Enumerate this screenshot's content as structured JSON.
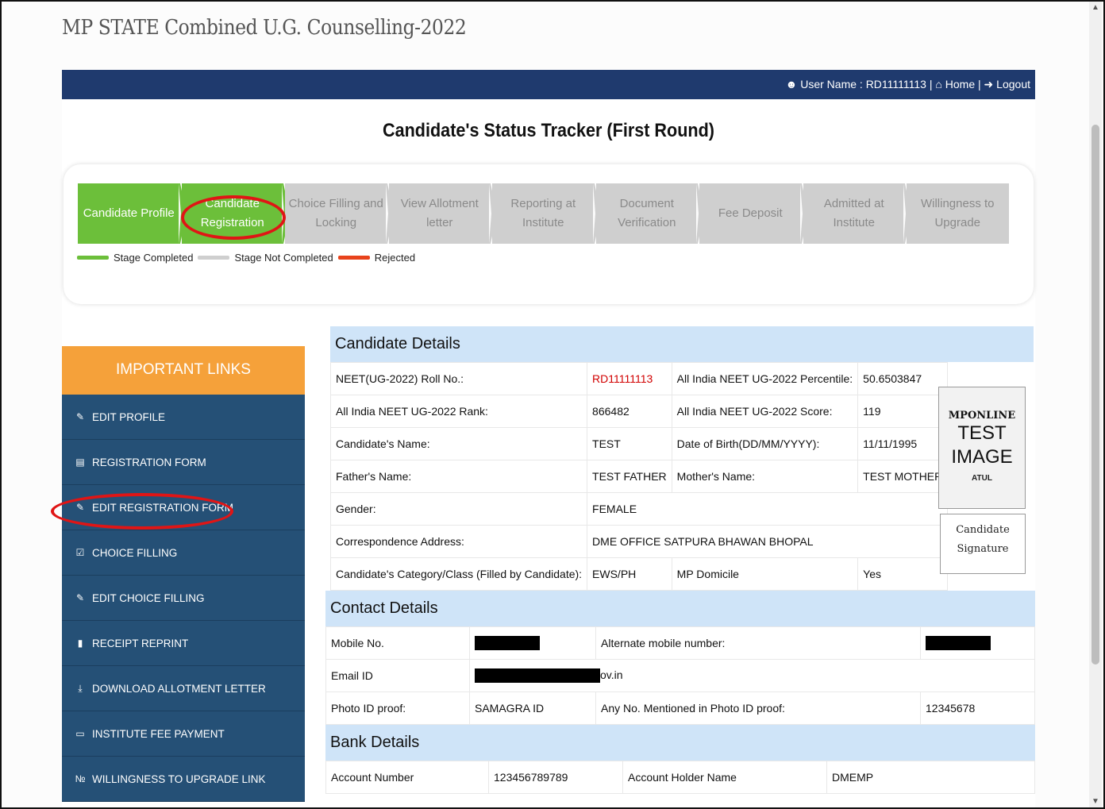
{
  "header": {
    "title": "MP STATE Combined U.G. Counselling-2022"
  },
  "topbar": {
    "user_label": "User Name : RD11111113",
    "home": "Home",
    "logout": "Logout",
    "sep": "|"
  },
  "tracker": {
    "title": "Candidate's Status Tracker (First Round)",
    "steps": [
      {
        "line1": "Candidate Profile",
        "line2": "",
        "status": "completed"
      },
      {
        "line1": "Candidate",
        "line2": "Registration",
        "status": "completed"
      },
      {
        "line1": "Choice Filling and",
        "line2": "Locking",
        "status": "not_completed"
      },
      {
        "line1": "View Allotment",
        "line2": "letter",
        "status": "not_completed"
      },
      {
        "line1": "Reporting at",
        "line2": "Institute",
        "status": "not_completed"
      },
      {
        "line1": "Document",
        "line2": "Verification",
        "status": "not_completed"
      },
      {
        "line1": "Fee Deposit",
        "line2": "",
        "status": "not_completed"
      },
      {
        "line1": "Admitted at",
        "line2": "Institute",
        "status": "not_completed"
      },
      {
        "line1": "Willingness to",
        "line2": "Upgrade",
        "status": "not_completed"
      }
    ],
    "legend": {
      "completed": "Stage Completed",
      "not_completed": "Stage Not Completed",
      "rejected": "Rejected"
    },
    "colors": {
      "completed": "#6cbf3a",
      "not_completed": "#cfcfcf",
      "rejected": "#e8431c"
    }
  },
  "sidebar": {
    "heading": "IMPORTANT LINKS",
    "items": [
      {
        "label": "EDIT PROFILE",
        "icon": "edit-icon"
      },
      {
        "label": "REGISTRATION FORM",
        "icon": "id-card-icon"
      },
      {
        "label": "EDIT REGISTRATION FORM",
        "icon": "edit-icon"
      },
      {
        "label": "CHOICE FILLING",
        "icon": "checkbox-icon"
      },
      {
        "label": "EDIT CHOICE FILLING",
        "icon": "edit-icon"
      },
      {
        "label": "RECEIPT REPRINT",
        "icon": "file-icon"
      },
      {
        "label": "DOWNLOAD ALLOTMENT LETTER",
        "icon": "download-icon"
      },
      {
        "label": "INSTITUTE FEE PAYMENT",
        "icon": "credit-card-icon"
      },
      {
        "label": "WILLINGNESS TO UPGRADE LINK",
        "icon": "link-icon"
      }
    ]
  },
  "candidate": {
    "heading": "Candidate Details",
    "roll_label": "NEET(UG-2022) Roll No.:",
    "roll": "RD11111113",
    "percentile_label": "All India NEET UG-2022 Percentile:",
    "percentile": "50.6503847",
    "rank_label": "All India NEET UG-2022 Rank:",
    "rank": "866482",
    "score_label": "All India NEET UG-2022 Score:",
    "score": "119",
    "name_label": "Candidate's Name:",
    "name": "TEST",
    "dob_label": "Date of Birth(DD/MM/YYYY):",
    "dob": "11/11/1995",
    "father_label": "Father's Name:",
    "father": "TEST FATHER",
    "mother_label": "Mother's Name:",
    "mother": "TEST MOTHER",
    "gender_label": "Gender:",
    "gender": "FEMALE",
    "address_label": "Correspondence Address:",
    "address": "DME OFFICE SATPURA BHAWAN BHOPAL",
    "category_label": "Candidate's Category/Class (Filled by Candidate):",
    "category": "EWS/PH",
    "domicile_label": "MP Domicile",
    "domicile": "Yes",
    "photo": {
      "line1": "MPONLINE",
      "line2": "TEST",
      "line3": "IMAGE",
      "line4": "ATUL"
    },
    "signature": {
      "line1": "Candidate",
      "line2": "Signature"
    }
  },
  "contact": {
    "heading": "Contact Details",
    "mobile_label": "Mobile No.",
    "alt_mobile_label": "Alternate mobile number:",
    "email_label": "Email ID",
    "email_suffix": "ov.in",
    "photo_id_label": "Photo ID proof:",
    "photo_id": "SAMAGRA ID",
    "photo_no_label": "Any No. Mentioned in Photo ID proof:",
    "photo_no": "12345678"
  },
  "bank": {
    "heading": "Bank Details",
    "account_label": "Account Number",
    "account": "123456789789",
    "holder_label": "Account Holder Name",
    "holder": "DMEMP"
  }
}
